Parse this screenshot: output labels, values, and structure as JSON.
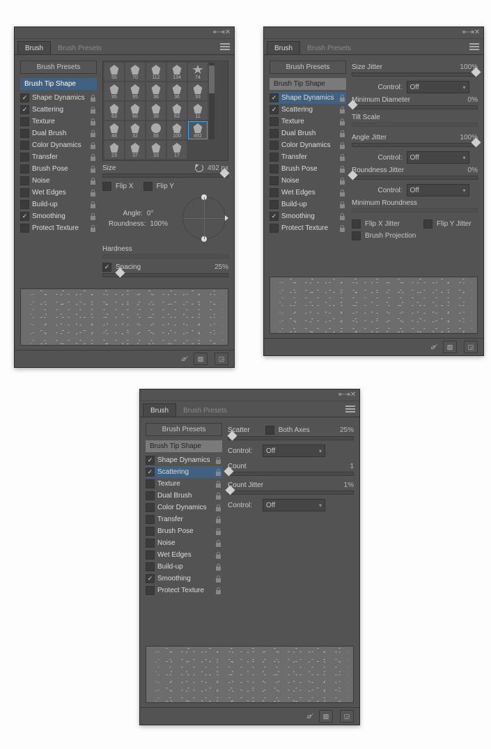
{
  "tabs": {
    "brush": "Brush",
    "presets": "Brush Presets"
  },
  "sidebar": {
    "presets_btn": "Brush Presets",
    "tip_label": "Brush Tip Shape",
    "items": [
      {
        "label": "Shape Dynamics"
      },
      {
        "label": "Scattering"
      },
      {
        "label": "Texture"
      },
      {
        "label": "Dual Brush"
      },
      {
        "label": "Color Dynamics"
      },
      {
        "label": "Transfer"
      },
      {
        "label": "Brush Pose"
      },
      {
        "label": "Noise"
      },
      {
        "label": "Wet Edges"
      },
      {
        "label": "Build-up"
      },
      {
        "label": "Smoothing"
      },
      {
        "label": "Protect Texture"
      }
    ]
  },
  "panel1": {
    "brush_numbers": [
      "55",
      "70",
      "112",
      "134",
      "74",
      "95",
      "95",
      "36",
      "36",
      "33",
      "63",
      "66",
      "39",
      "63",
      "11",
      "48",
      "32",
      "55",
      "100",
      "492",
      "23",
      "37",
      "33",
      "17"
    ],
    "selected_index": 19,
    "size_label": "Size",
    "size_value": "492",
    "flipx": "Flip X",
    "flipy": "Flip Y",
    "angle_label": "Angle:",
    "angle_value": "0°",
    "roundness_label": "Roundness:",
    "roundness_value": "100",
    "hardness_label": "Hardness",
    "spacing_label": "Spacing",
    "spacing_value": "25"
  },
  "panel2": {
    "size_jitter_label": "Size Jitter",
    "size_jitter_value": "100",
    "control_label": "Control:",
    "control_off": "Off",
    "min_diameter_label": "Minimum Diameter",
    "min_diameter_value": "0",
    "tilt_label": "Tilt Scale",
    "angle_jitter_label": "Angle Jitter",
    "angle_jitter_value": "100",
    "roundness_jitter_label": "Roundness Jitter",
    "roundness_jitter_value": "0",
    "min_roundness_label": "Minimum Roundness",
    "flipx_jitter": "Flip X Jitter",
    "flipy_jitter": "Flip Y Jitter",
    "brush_projection": "Brush Projection"
  },
  "panel3": {
    "scatter_label": "Scatter",
    "both_axes": "Both Axes",
    "scatter_value": "25",
    "control_label": "Control:",
    "control_off": "Off",
    "count_label": "Count",
    "count_value": "1",
    "count_jitter_label": "Count Jitter",
    "count_jitter_value": "1"
  }
}
